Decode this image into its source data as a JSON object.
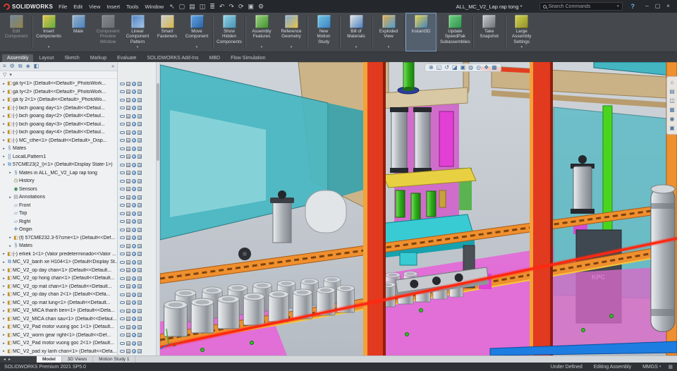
{
  "titlebar": {
    "app_name": "SOLIDWORKS",
    "menus": [
      "File",
      "Edit",
      "View",
      "Insert",
      "Tools",
      "Window"
    ],
    "toolbar_icons": [
      {
        "name": "select-arrow-icon",
        "glyph": "↖"
      },
      {
        "name": "new-document-icon",
        "glyph": "▢"
      },
      {
        "name": "open-document-icon",
        "glyph": "▤"
      },
      {
        "name": "save-icon",
        "glyph": "◫"
      },
      {
        "name": "print-icon",
        "glyph": "≣"
      },
      {
        "name": "undo-icon",
        "glyph": "↶"
      },
      {
        "name": "redo-icon",
        "glyph": "↷"
      },
      {
        "name": "rebuild-icon",
        "glyph": "⟳"
      },
      {
        "name": "file-properties-icon",
        "glyph": "▣"
      },
      {
        "name": "options-icon",
        "glyph": "⚙"
      }
    ],
    "document_title": "ALL_MC_V2_Lap rap tong *",
    "search_placeholder": "Search Commands",
    "search_caret": "▾",
    "help_label": "?",
    "window_controls": [
      {
        "name": "minimize-button",
        "glyph": "–"
      },
      {
        "name": "maximize-button",
        "glyph": "▢"
      },
      {
        "name": "close-button",
        "glyph": "×"
      }
    ]
  },
  "ribbon": {
    "separators_after": [
      0,
      6,
      7,
      9,
      10,
      11,
      12,
      13,
      14,
      15
    ],
    "buttons": [
      {
        "label": "Edit\nComponent",
        "icon": "edit-component-icon",
        "icon_colors": [
          "#8fb8e0",
          "#d9b64a"
        ],
        "enabled": false
      },
      {
        "label": "Insert\nComponents",
        "icon": "insert-components-icon",
        "icon_colors": [
          "#e8c44a",
          "#5fae3f"
        ],
        "arrow": true
      },
      {
        "label": "Mate",
        "icon": "mate-icon",
        "icon_colors": [
          "#9ab4c8",
          "#4a7fbf"
        ]
      },
      {
        "label": "Component\nPreview\nWindow",
        "icon": "component-preview-window-icon",
        "icon_colors": [
          "#b8bcc0",
          "#888c90"
        ],
        "enabled": false
      },
      {
        "label": "Linear\nComponent\nPattern",
        "icon": "linear-component-pattern-icon",
        "icon_colors": [
          "#4a7fbf",
          "#a8c8e8"
        ],
        "arrow": true
      },
      {
        "label": "Smart\nFasteners",
        "icon": "smart-fasteners-icon",
        "icon_colors": [
          "#c8cdd2",
          "#d9b64a"
        ]
      },
      {
        "label": "Move\nComponent",
        "icon": "move-component-icon",
        "icon_colors": [
          "#5fa8e8",
          "#2f5f9f"
        ],
        "arrow": true
      },
      {
        "label": "Show\nHidden\nComponents",
        "icon": "show-hidden-components-icon",
        "icon_colors": [
          "#8fd4e8",
          "#4a8faf"
        ]
      },
      {
        "label": "Assembly\nFeatures",
        "icon": "assembly-features-icon",
        "icon_colors": [
          "#9fd47f",
          "#3f8f2f"
        ],
        "arrow": true
      },
      {
        "label": "Reference\nGeometry",
        "icon": "reference-geometry-icon",
        "icon_colors": [
          "#7fa8d9",
          "#e8c44a"
        ],
        "arrow": true
      },
      {
        "label": "New\nMotion\nStudy",
        "icon": "new-motion-study-icon",
        "icon_colors": [
          "#6fc8e8",
          "#3f7fbf"
        ]
      },
      {
        "label": "Bill of\nMaterials",
        "icon": "bill-of-materials-icon",
        "icon_colors": [
          "#e8e8e8",
          "#4a7fbf"
        ],
        "arrow": true
      },
      {
        "label": "Exploded\nView",
        "icon": "exploded-view-icon",
        "icon_colors": [
          "#e8a84a",
          "#4a9fd4"
        ],
        "arrow": true
      },
      {
        "label": "Instant3D",
        "icon": "instant3d-icon",
        "icon_colors": [
          "#e8d44a",
          "#3f7fbf"
        ],
        "active": true
      },
      {
        "label": "Update\nSpeedPak\nSubassemblies",
        "icon": "update-speedpak-subassemblies-icon",
        "icon_colors": [
          "#6fd47f",
          "#2f8f4f"
        ]
      },
      {
        "label": "Take\nSnapshot",
        "icon": "take-snapshot-icon",
        "icon_colors": [
          "#c8cdd2",
          "#6a6f74"
        ]
      },
      {
        "label": "Large\nAssembly\nSettings",
        "icon": "large-assembly-settings-icon",
        "icon_colors": [
          "#d4d44a",
          "#8f8f2f"
        ],
        "arrow": true
      }
    ]
  },
  "command_tabs": [
    {
      "label": "Assembly",
      "active": true
    },
    {
      "label": "Layout"
    },
    {
      "label": "Sketch"
    },
    {
      "label": "Markup"
    },
    {
      "label": "Evaluate"
    },
    {
      "label": "SOLIDWORKS Add-Ins"
    },
    {
      "label": "MBD"
    },
    {
      "label": "Flow Simulation"
    }
  ],
  "feature_panel": {
    "tab_icons": [
      {
        "name": "featuremanager-tab-icon",
        "glyph": "≡"
      },
      {
        "name": "propertymanager-tab-icon",
        "glyph": "⚙"
      },
      {
        "name": "configurationmanager-tab-icon",
        "glyph": "⧉"
      },
      {
        "name": "dimxpert-tab-icon",
        "glyph": "◈"
      },
      {
        "name": "displaymanager-tab-icon",
        "glyph": "◧"
      }
    ],
    "collapse_glyph": "«",
    "filter_glyph": "▽",
    "filter_caret": "▾",
    "icon_glyphs": {
      "part": "◧",
      "assembly": "⧉",
      "mates": "§",
      "pattern": "⣿",
      "history": "◷",
      "sensors": "◉",
      "annotations": "▤",
      "plane": "▱",
      "origin": "✛"
    },
    "items": [
      {
        "label": "gá ty<1> (Default<<Default>_PhotoWork...",
        "icon": "part",
        "indent": 0,
        "arrow": "r"
      },
      {
        "label": "gá ty<2> (Default<<Default>_PhotoWork...",
        "icon": "part",
        "indent": 0,
        "arrow": "r"
      },
      {
        "label": "gá ty 2<1> (Default<<Default>_PhotoWo...",
        "icon": "part",
        "indent": 0,
        "arrow": "r"
      },
      {
        "label": "(-) bich gioang day<1> (Default<<Defaul...",
        "icon": "part",
        "indent": 0,
        "arrow": "r"
      },
      {
        "label": "(-) bich gioang day<2> (Default<<Defaul...",
        "icon": "part",
        "indent": 0,
        "arrow": "r"
      },
      {
        "label": "(-) bich gioang day<3> (Default<<Defaul...",
        "icon": "part",
        "indent": 0,
        "arrow": "r"
      },
      {
        "label": "(-) bich gioang day<4> (Default<<Defaul...",
        "icon": "part",
        "indent": 0,
        "arrow": "r"
      },
      {
        "label": "(-) MC_cthe<1> (Default<<Default>_Disp...",
        "icon": "part",
        "indent": 0,
        "arrow": "r"
      },
      {
        "label": "Mates",
        "icon": "mates",
        "indent": 0,
        "arrow": "r"
      },
      {
        "label": "LocalLPattern1",
        "icon": "pattern",
        "indent": 0,
        "arrow": "r"
      },
      {
        "label": "57CME23(2_l)<1> (Default<Display State-1>)",
        "icon": "assembly",
        "indent": 0,
        "arrow": "d"
      },
      {
        "label": "Mates in ALL_MC_V2_Lap rap tong",
        "icon": "mates",
        "indent": 1,
        "arrow": "r"
      },
      {
        "label": "History",
        "icon": "history",
        "indent": 1,
        "arrow": ""
      },
      {
        "label": "Sensors",
        "icon": "sensors",
        "indent": 1,
        "arrow": ""
      },
      {
        "label": "Annotations",
        "icon": "annotations",
        "indent": 1,
        "arrow": "r"
      },
      {
        "label": "Front",
        "icon": "plane",
        "indent": 1,
        "arrow": ""
      },
      {
        "label": "Top",
        "icon": "plane",
        "indent": 1,
        "arrow": ""
      },
      {
        "label": "Right",
        "icon": "plane",
        "indent": 1,
        "arrow": ""
      },
      {
        "label": "Origin",
        "icon": "origin",
        "indent": 1,
        "arrow": ""
      },
      {
        "label": "(f) 57CME232.3-57cme<1> (Default<<Def...",
        "icon": "part",
        "indent": 1,
        "arrow": "r"
      },
      {
        "label": "Mates",
        "icon": "mates",
        "indent": 1,
        "arrow": "r"
      },
      {
        "label": "(-) erkek 1<1> (Valor predeterminado<<Valor ...",
        "icon": "part",
        "indent": 0,
        "arrow": "r"
      },
      {
        "label": "MC_V2_banh xe H104<1> (Default<Display St...",
        "icon": "assembly",
        "indent": 0,
        "arrow": "r"
      },
      {
        "label": "MC_V2_op day chan<1> (Default<<Default...",
        "icon": "part",
        "indent": 0,
        "arrow": "r"
      },
      {
        "label": "MC_V2_op hong chan<1> (Default<<Default...",
        "icon": "part",
        "indent": 0,
        "arrow": "r"
      },
      {
        "label": "MC_V2_op mat chan<1> (Default<<Default...",
        "icon": "part",
        "indent": 0,
        "arrow": "r"
      },
      {
        "label": "MC_V2_op day chan 2<1> (Default<<Defa...",
        "icon": "part",
        "indent": 0,
        "arrow": "r"
      },
      {
        "label": "MC_V2_op mat lung<1> (Default<<Default...",
        "icon": "part",
        "indent": 0,
        "arrow": "r"
      },
      {
        "label": "MC_V2_MICA thanh ben<1> (Default<<Defa...",
        "icon": "part",
        "indent": 0,
        "arrow": "r"
      },
      {
        "label": "MC_V2_MICA chan sau<1> (Default<<Defaul...",
        "icon": "part",
        "indent": 0,
        "arrow": "r"
      },
      {
        "label": "MC_V2_Pad motor vuong goc 1<1> (Default...",
        "icon": "part",
        "indent": 0,
        "arrow": "r"
      },
      {
        "label": "MC_V2_worm gear right<1> (Default<<Def...",
        "icon": "part",
        "indent": 0,
        "arrow": "r"
      },
      {
        "label": "MC_V2_Pad motor vuong goc 2<1> (Default...",
        "icon": "part",
        "indent": 0,
        "arrow": "r"
      },
      {
        "label": "MC_V2_pad xy lanh chan<1> (Default<<Defa...",
        "icon": "part",
        "indent": 0,
        "arrow": "r"
      }
    ]
  },
  "viewport": {
    "hud_icons": [
      {
        "name": "zoom-fit-icon",
        "glyph": "⊕"
      },
      {
        "name": "zoom-area-icon",
        "glyph": "◱"
      },
      {
        "name": "previous-view-icon",
        "glyph": "↺"
      },
      {
        "name": "section-view-icon",
        "glyph": "◪"
      },
      {
        "name": "view-orientation-icon",
        "glyph": "▣"
      },
      {
        "name": "display-style-icon",
        "glyph": "◍"
      },
      {
        "name": "hide-show-items-icon",
        "glyph": "◎"
      },
      {
        "name": "edit-appearance-icon",
        "glyph": "❖"
      },
      {
        "name": "apply-scene-icon",
        "glyph": "▦"
      }
    ],
    "taskpane_icons": [
      {
        "name": "home-icon",
        "glyph": "⌂"
      },
      {
        "name": "design-library-icon",
        "glyph": "▤"
      },
      {
        "name": "file-explorer-icon",
        "glyph": "◫"
      },
      {
        "name": "view-palette-icon",
        "glyph": "▦"
      },
      {
        "name": "appearances-icon",
        "glyph": "◉"
      },
      {
        "name": "custom-properties-icon",
        "glyph": "▣"
      }
    ],
    "kpc_label": "KPC",
    "colors": {
      "teal": "#47b8c3",
      "orange": "#ef8f2e",
      "red": "#e23a1e",
      "magenta": "#e468d8",
      "green": "#2fae1b",
      "blue": "#1e7de0",
      "yellow": "#e7d142",
      "can_silver": "#c2c6ca"
    }
  },
  "bottom_bar": {
    "nav_icons": [
      {
        "name": "tab-scroll-left-icon",
        "glyph": "◂"
      },
      {
        "name": "tab-scroll-right-icon",
        "glyph": "▸"
      }
    ],
    "tabs": [
      {
        "label": "Model",
        "active": true
      },
      {
        "label": "3D Views"
      },
      {
        "label": "Motion Study 1"
      }
    ]
  },
  "status_bar": {
    "left": "SOLIDWORKS Premium 2021 SP5.0",
    "items": [
      "Under Defined",
      "Editing Assembly",
      "MMGS"
    ],
    "caret": "▾",
    "icon_glyph": "▦"
  }
}
